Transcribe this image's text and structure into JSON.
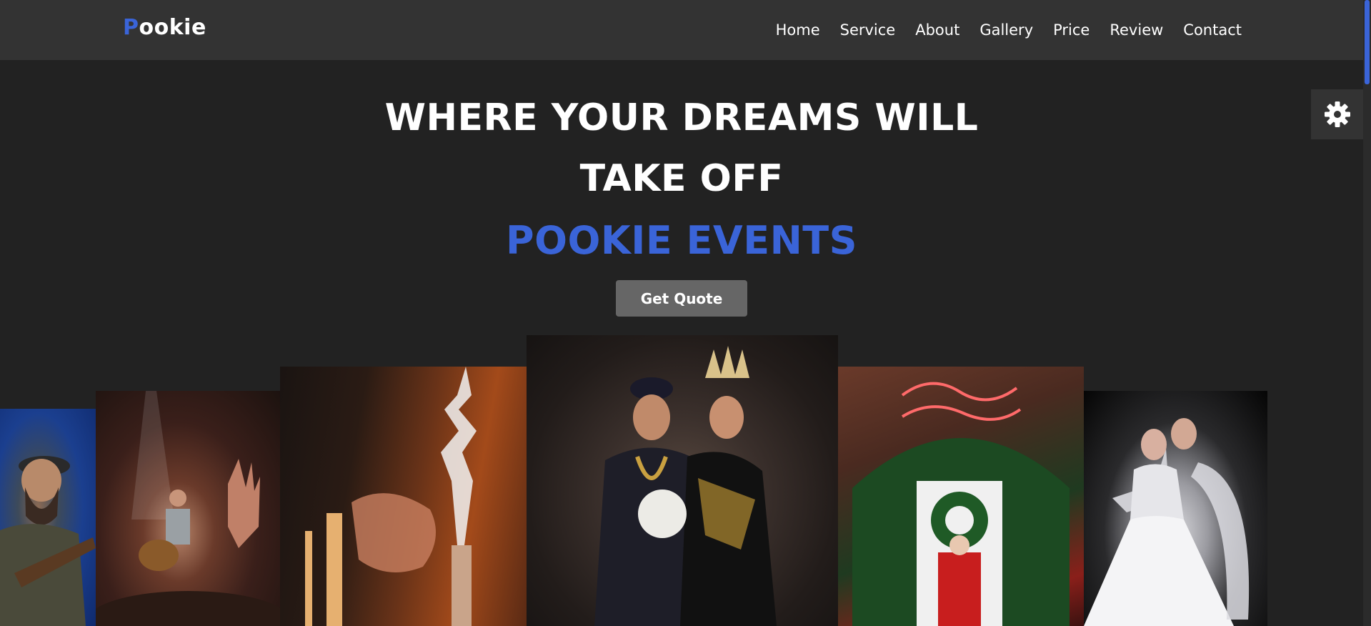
{
  "brand": {
    "initial": "P",
    "rest": "ookie",
    "accent_color": "#3a64d8"
  },
  "nav": {
    "items": [
      {
        "label": "Home"
      },
      {
        "label": "Service"
      },
      {
        "label": "About"
      },
      {
        "label": "Gallery"
      },
      {
        "label": "Price"
      },
      {
        "label": "Review"
      },
      {
        "label": "Contact"
      }
    ]
  },
  "settings": {
    "icon": "gear-icon"
  },
  "hero": {
    "line1": "WHERE YOUR DREAMS WILL",
    "line2": "TAKE OFF",
    "line3": "POOKIE EVENTS",
    "cta_label": "Get Quote"
  },
  "gallery": {
    "images": [
      {
        "name": "gallery-image-guitarist"
      },
      {
        "name": "gallery-image-concert"
      },
      {
        "name": "gallery-image-sparkler"
      },
      {
        "name": "gallery-image-wedding-couple"
      },
      {
        "name": "gallery-image-christmas-door"
      },
      {
        "name": "gallery-image-bride-groom"
      }
    ]
  },
  "colors": {
    "background": "#222222",
    "header": "#333333",
    "accent": "#3a64d8",
    "button": "#666666"
  }
}
